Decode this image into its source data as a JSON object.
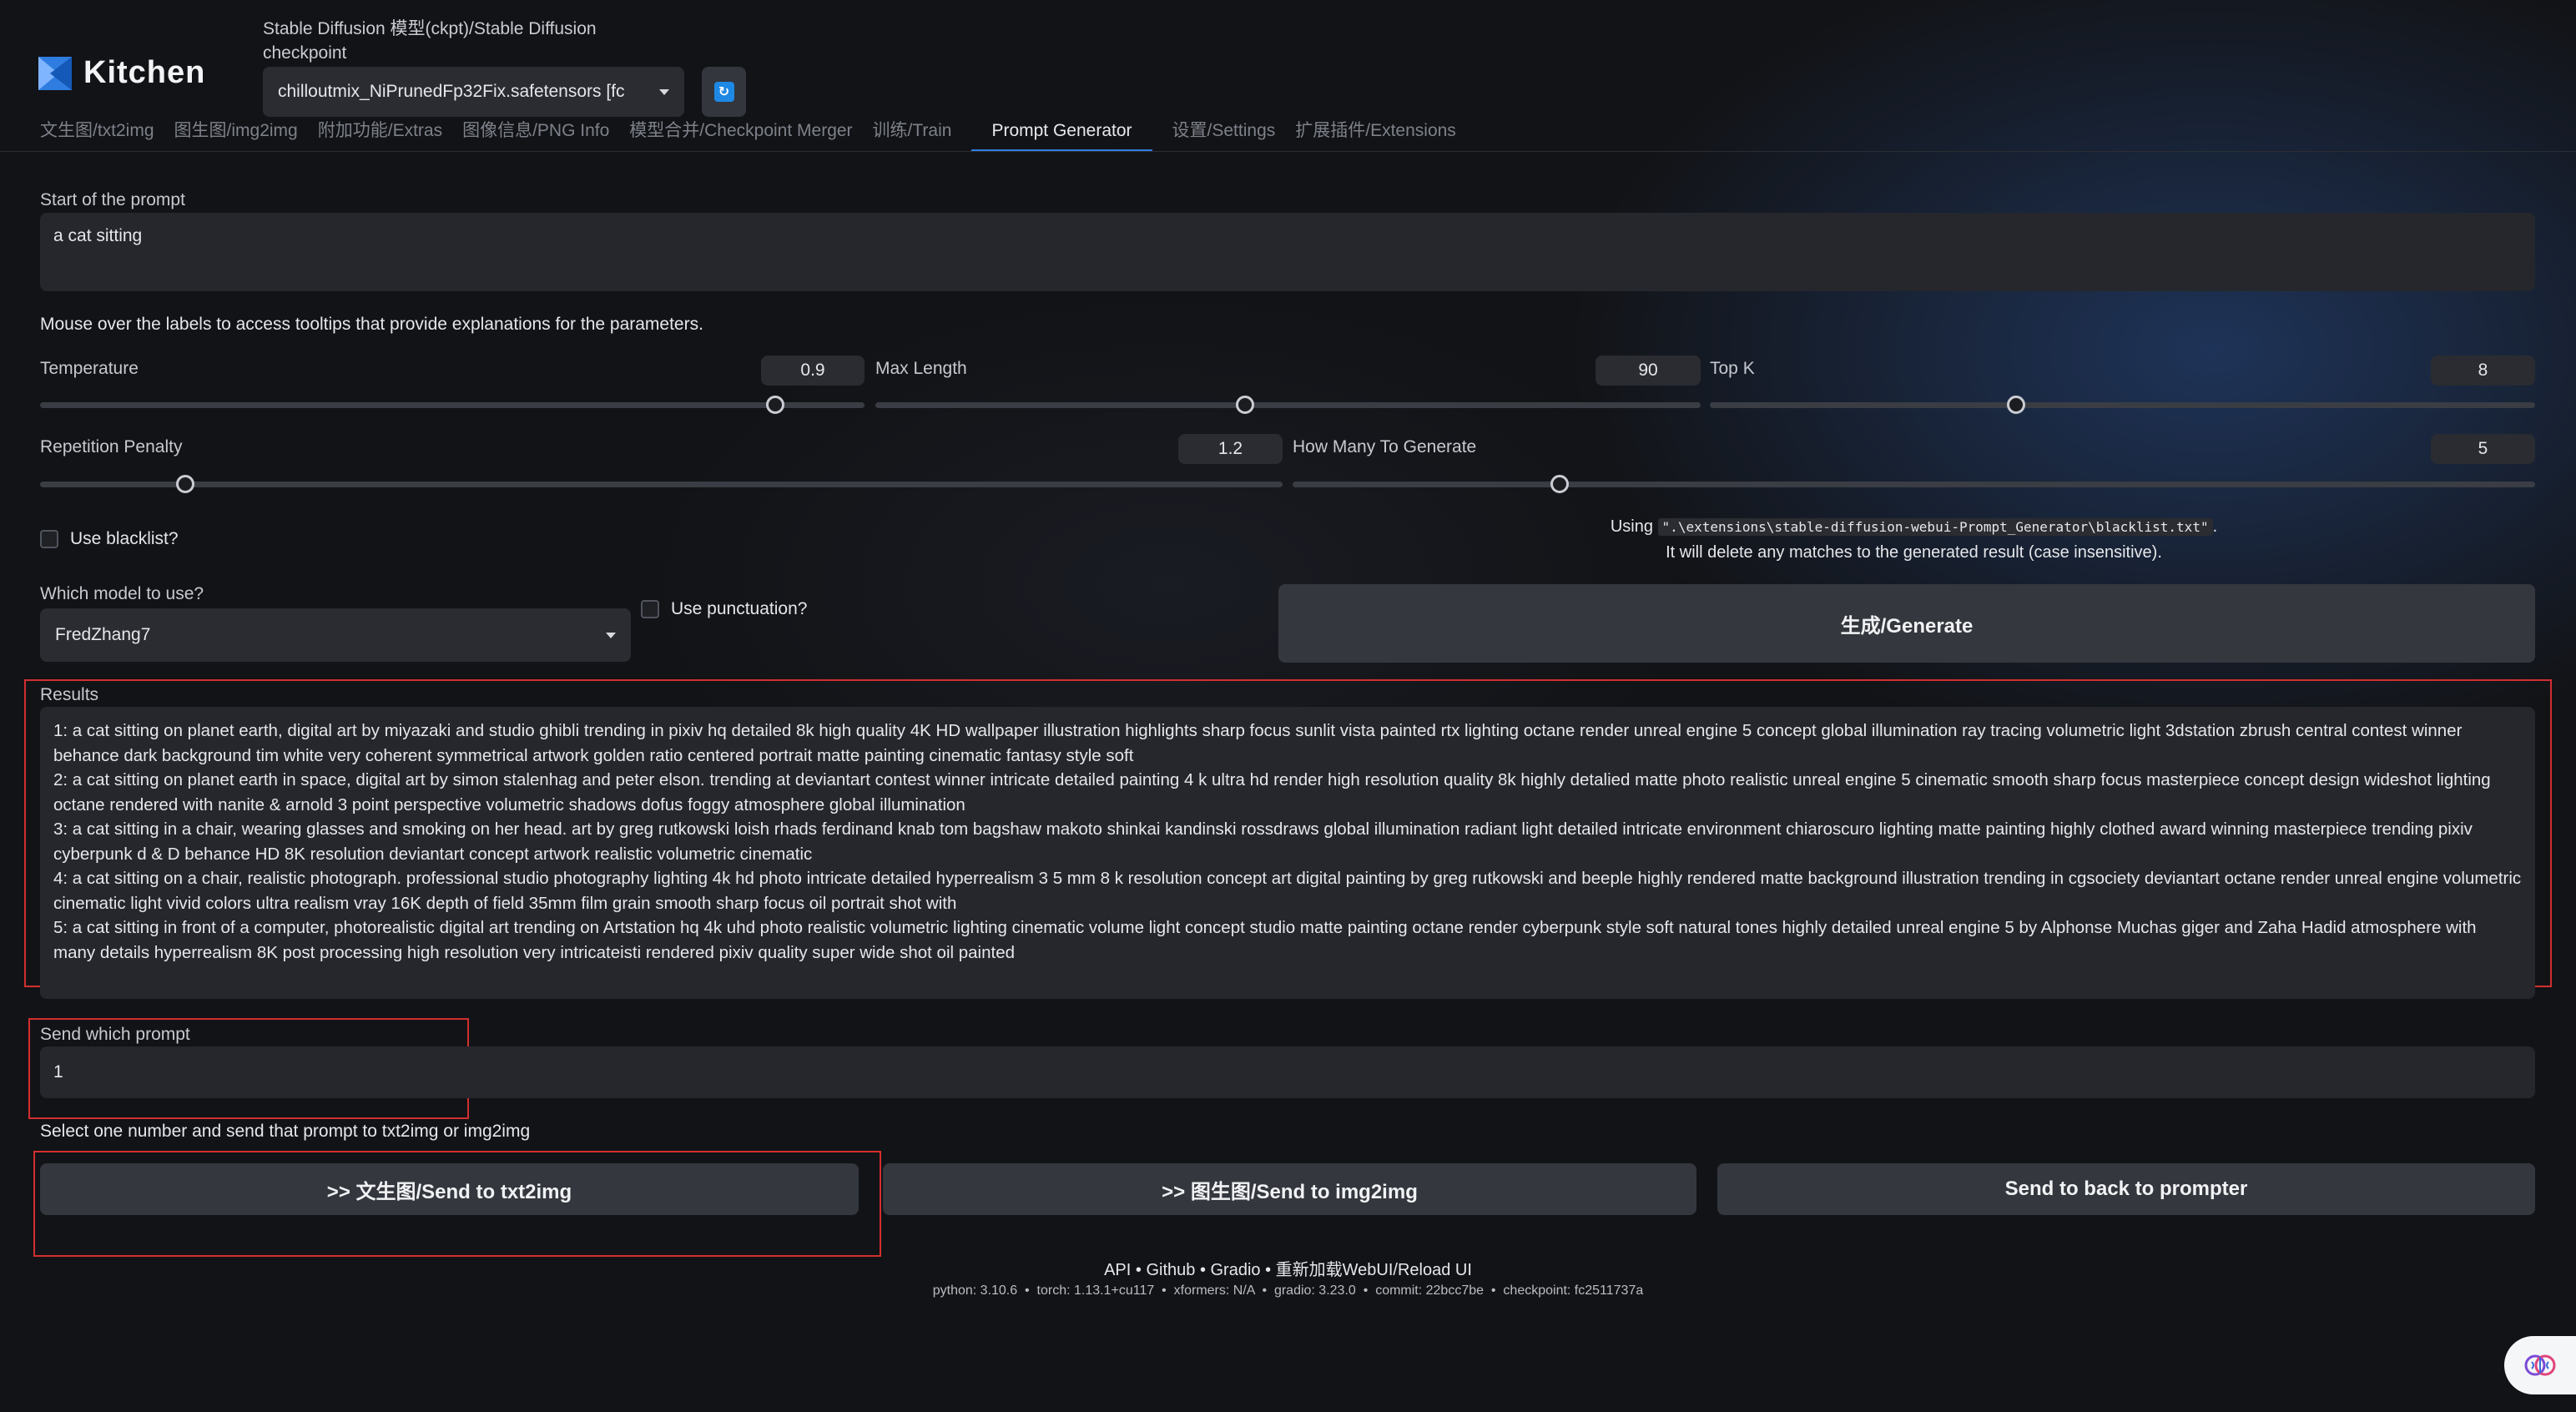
{
  "app": {
    "name": "Kitchen"
  },
  "checkpoint": {
    "label": "Stable Diffusion 模型(ckpt)/Stable Diffusion checkpoint",
    "value": "chilloutmix_NiPrunedFp32Fix.safetensors [fc"
  },
  "tabs": [
    {
      "label": "文生图/txt2img"
    },
    {
      "label": "图生图/img2img"
    },
    {
      "label": "附加功能/Extras"
    },
    {
      "label": "图像信息/PNG Info"
    },
    {
      "label": "模型合并/Checkpoint Merger"
    },
    {
      "label": "训练/Train"
    },
    {
      "label": "Prompt Generator",
      "active": true
    },
    {
      "label": "设置/Settings"
    },
    {
      "label": "扩展插件/Extensions"
    }
  ],
  "prompt_start": {
    "label": "Start of the prompt",
    "value": "a cat sitting"
  },
  "tooltip_hint": "Mouse over the labels to access tooltips that provide explanations for the parameters.",
  "sliders": {
    "temperature": {
      "label": "Temperature",
      "value": "0.9",
      "fraction": 0.89
    },
    "max_length": {
      "label": "Max Length",
      "value": "90",
      "fraction": 0.45
    },
    "top_k": {
      "label": "Top K",
      "value": "8",
      "fraction": 0.37
    },
    "repetition_penalty": {
      "label": "Repetition Penalty",
      "value": "1.2",
      "fraction": 0.12
    },
    "how_many": {
      "label": "How Many To Generate",
      "value": "5",
      "fraction": 0.21
    }
  },
  "blacklist": {
    "label": "Use blacklist?",
    "using_prefix": "Using ",
    "path": "\".\\extensions\\stable-diffusion-webui-Prompt_Generator\\blacklist.txt\"",
    "using_suffix": ".",
    "note": "It will delete any matches to the generated result (case insensitive)."
  },
  "model": {
    "label": "Which model to use?",
    "value": "FredZhang7"
  },
  "punctuation": {
    "label": "Use punctuation?"
  },
  "generate_button": "生成/Generate",
  "results": {
    "label": "Results",
    "lines": [
      "1: a cat sitting on planet earth, digital art by miyazaki and studio ghibli trending in pixiv hq detailed 8k high quality 4K HD wallpaper illustration highlights sharp focus sunlit vista painted rtx lighting octane render unreal engine 5 concept global illumination ray tracing volumetric light 3dstation zbrush central contest winner behance dark background tim white very coherent symmetrical artwork golden ratio centered portrait matte painting cinematic fantasy style soft",
      "2: a cat sitting on planet earth in space, digital art by simon stalenhag and peter elson. trending at deviantart contest winner intricate detailed painting 4 k ultra hd render high resolution quality 8k highly detalied matte photo realistic unreal engine 5 cinematic smooth sharp focus masterpiece concept design wideshot lighting octane rendered with nanite & arnold 3 point perspective volumetric shadows dofus foggy atmosphere global illumination",
      "3: a cat sitting in a chair, wearing glasses and smoking on her head. art by greg rutkowski loish rhads ferdinand knab tom bagshaw makoto shinkai kandinski rossdraws global illumination radiant light detailed intricate environment chiaroscuro lighting matte painting highly clothed award winning masterpiece trending pixiv cyberpunk d & D behance HD 8K resolution deviantart concept artwork realistic volumetric cinematic",
      "4: a cat sitting on a chair, realistic photograph. professional studio photography lighting 4k hd photo intricate detailed hyperrealism 3 5 mm 8 k resolution concept art digital painting by greg rutkowski and beeple highly rendered matte background illustration trending in cgsociety deviantart octane render unreal engine volumetric cinematic light vivid colors ultra realism vray 16K depth of field 35mm film grain smooth sharp focus oil portrait shot with",
      "5: a cat sitting in front of a computer, photorealistic digital art trending on Artstation hq 4k uhd photo realistic volumetric lighting cinematic volume light concept studio matte painting octane render cyberpunk style soft natural tones highly detailed unreal engine 5 by Alphonse Muchas giger and Zaha Hadid atmosphere with many details hyperrealism 8K post processing high resolution very intricateisti rendered pixiv quality super wide shot oil painted"
    ]
  },
  "send_which": {
    "label": "Send which prompt",
    "value": "1"
  },
  "select_hint": "Select one number and send that prompt to txt2img or img2img",
  "buttons": {
    "txt2img": ">> 文生图/Send to txt2img",
    "img2img": ">> 图生图/Send to img2img",
    "prompter": "Send to back to prompter"
  },
  "footer": {
    "links": [
      "API",
      "Github",
      "Gradio",
      "重新加载WebUI/Reload UI"
    ],
    "meta": [
      "python: 3.10.6",
      "torch: 1.13.1+cu117",
      "xformers: N/A",
      "gradio: 3.23.0",
      "commit: 22bcc7be",
      "checkpoint: fc2511737a"
    ]
  },
  "colors": {
    "accent": "#2f7de1",
    "highlight_frame": "#d32f2f",
    "background": "#121316"
  }
}
